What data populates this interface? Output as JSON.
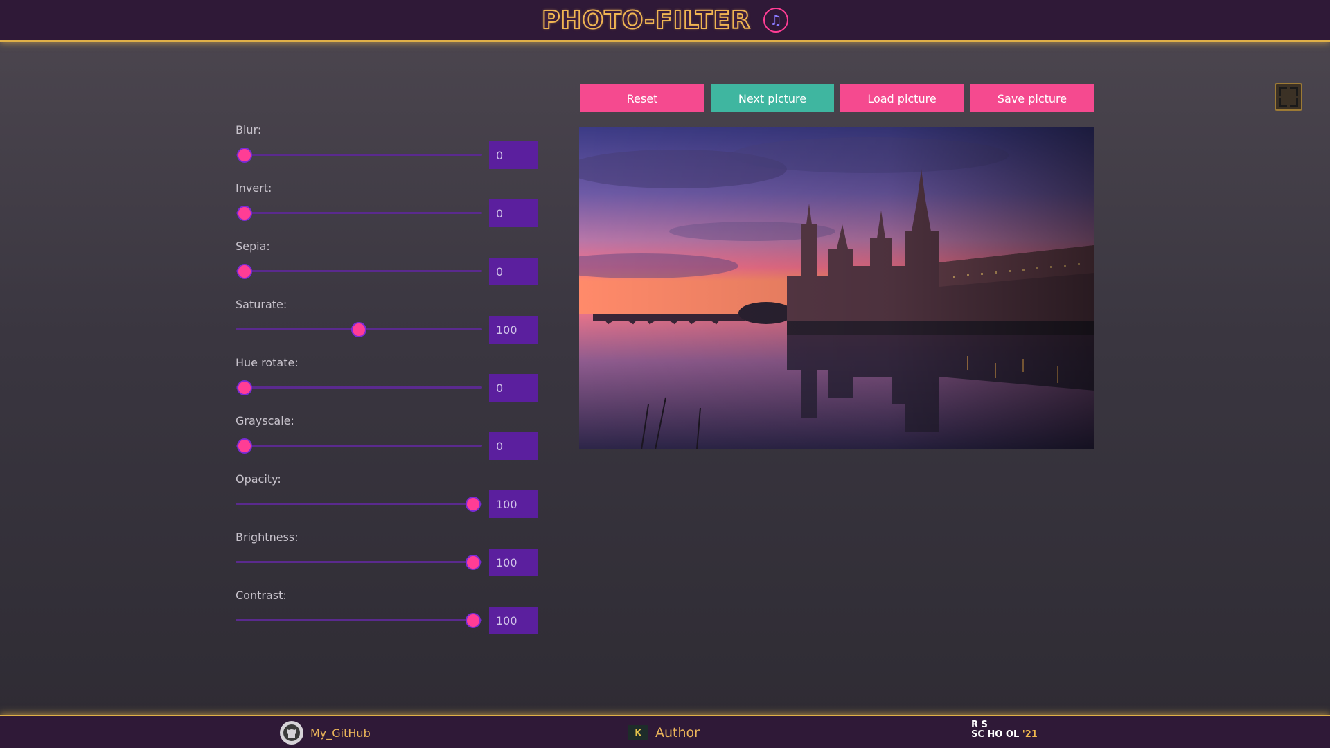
{
  "header": {
    "title": "PHOTO-FILTER",
    "music_icon": "music-note-icon"
  },
  "filters": [
    {
      "label": "Blur:",
      "value": "0",
      "min": 0,
      "max": 10,
      "fraction": 0
    },
    {
      "label": "Invert:",
      "value": "0",
      "min": 0,
      "max": 100,
      "fraction": 0
    },
    {
      "label": "Sepia:",
      "value": "0",
      "min": 0,
      "max": 100,
      "fraction": 0
    },
    {
      "label": "Saturate:",
      "value": "100",
      "min": 0,
      "max": 200,
      "fraction": 0.5
    },
    {
      "label": "Hue rotate:",
      "value": "0",
      "min": 0,
      "max": 360,
      "fraction": 0
    },
    {
      "label": "Grayscale:",
      "value": "0",
      "min": 0,
      "max": 100,
      "fraction": 0
    },
    {
      "label": "Opacity:",
      "value": "100",
      "min": 0,
      "max": 100,
      "fraction": 1
    },
    {
      "label": "Brightness:",
      "value": "100",
      "min": 0,
      "max": 200,
      "fraction": 1
    },
    {
      "label": "Contrast:",
      "value": "100",
      "min": 0,
      "max": 200,
      "fraction": 1
    }
  ],
  "buttons": {
    "reset": "Reset",
    "next": "Next picture",
    "load": "Load picture",
    "save": "Save picture"
  },
  "colors": {
    "accent_pink": "#f54a8f",
    "accent_teal": "#3fb6a0",
    "header_bg": "#2f1937",
    "gold": "#e0b048"
  },
  "footer": {
    "github_label": "My_GitHub",
    "author_label": "Author",
    "author_icon_text": "K",
    "school_logo": {
      "line1": "R   S",
      "line2": "SC HO OL",
      "year": "'21"
    }
  }
}
